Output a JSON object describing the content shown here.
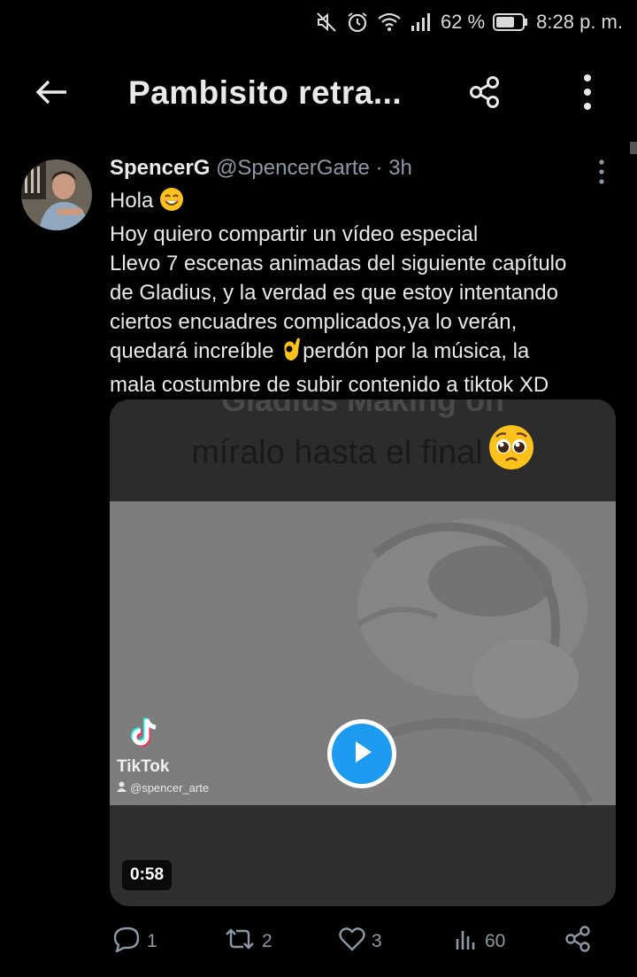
{
  "status_bar": {
    "battery": "62 %",
    "time": "8:28 p. m.",
    "icons": [
      "mute-icon",
      "alarm-icon",
      "wifi-icon",
      "signal-icon",
      "battery-icon"
    ]
  },
  "app_bar": {
    "title": "Pambisito retra...",
    "icons": [
      "back-arrow-icon",
      "share-icon",
      "more-vertical-icon"
    ]
  },
  "tweet": {
    "name": "SpencerG",
    "handle": "@SpencerGarte",
    "separator": "·",
    "time": "3h",
    "lines": [
      "Hola",
      "Hoy quiero compartir un vídeo especial",
      "Llevo 7 escenas animadas del siguiente capítulo",
      "de Gladius, y la verdad es que estoy intentando",
      "ciertos encuadres complicados,ya lo verán,",
      "quedará increíble",
      "perdón por la música, la",
      "mala costumbre de subir contenido a tiktok XD"
    ],
    "emojis": [
      "smiling-face-emoji",
      "ok-hand-emoji",
      "pleading-face-emoji"
    ],
    "media": {
      "ghost_text": "Gladius Making on",
      "caption": "míralo hasta el final",
      "tiktok_brand": "TikTok",
      "tiktok_user": "@spencer_arte",
      "duration": "0:58",
      "play_color": "#1d9bf0"
    },
    "actions": {
      "replies": "1",
      "retweets": "2",
      "likes": "3",
      "views": "60"
    }
  },
  "colors": {
    "background": "#000000",
    "text": "#e7e9ea",
    "secondary": "#8b98a5",
    "accent": "#1d9bf0"
  }
}
